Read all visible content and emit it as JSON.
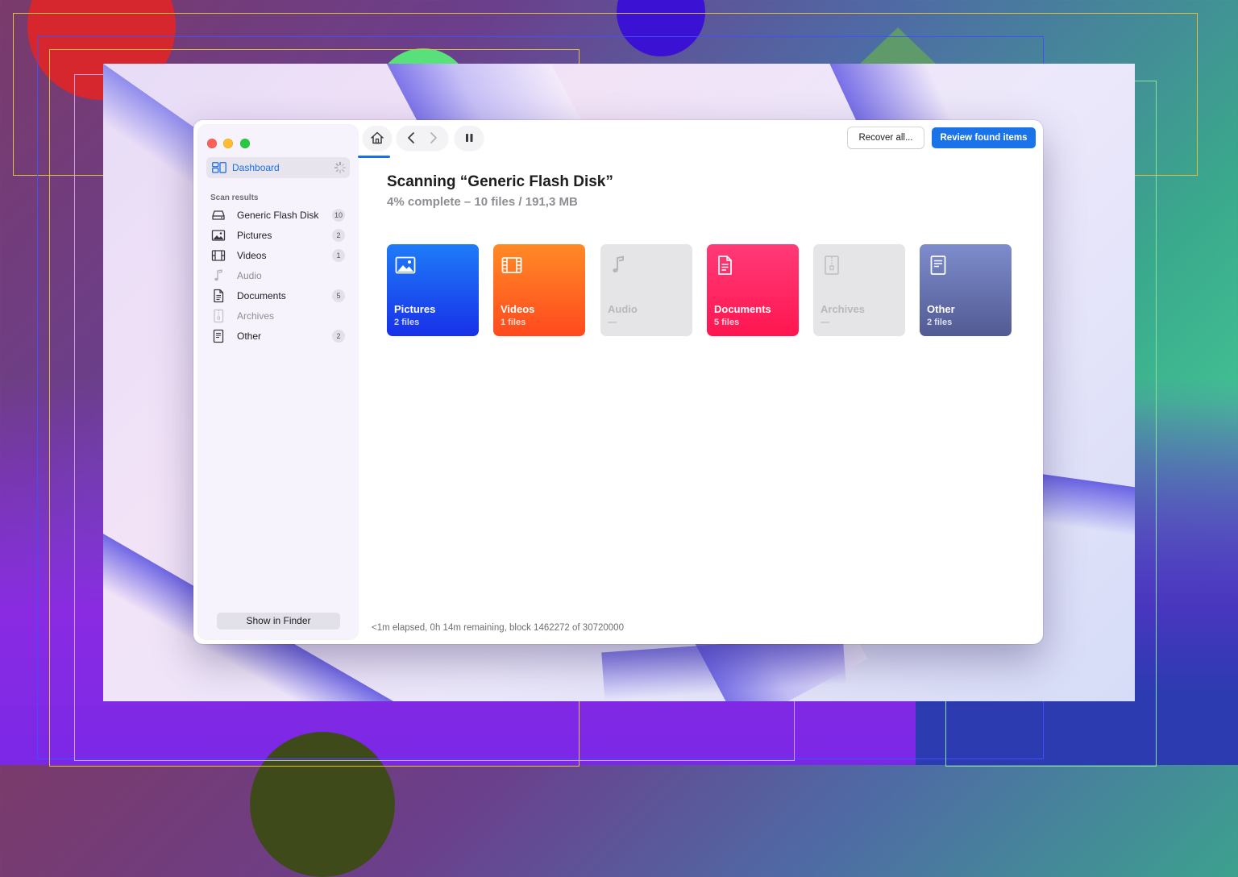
{
  "window": {
    "toolbar": {
      "recover_label": "Recover all...",
      "review_label": "Review found items"
    },
    "sidebar": {
      "dashboard_label": "Dashboard",
      "section_title": "Scan results",
      "items": [
        {
          "label": "Generic Flash Disk",
          "badge": "10",
          "icon": "drive-icon"
        },
        {
          "label": "Pictures",
          "badge": "2",
          "icon": "picture-icon"
        },
        {
          "label": "Videos",
          "badge": "1",
          "icon": "film-icon"
        },
        {
          "label": "Audio",
          "badge": "",
          "icon": "music-note-icon"
        },
        {
          "label": "Documents",
          "badge": "5",
          "icon": "document-icon"
        },
        {
          "label": "Archives",
          "badge": "",
          "icon": "archive-icon"
        },
        {
          "label": "Other",
          "badge": "2",
          "icon": "other-file-icon"
        }
      ],
      "finder_label": "Show in Finder"
    },
    "main": {
      "title": "Scanning “Generic Flash Disk”",
      "subtitle": "4% complete – 10 files / 191,3 MB",
      "cards": [
        {
          "name": "Pictures",
          "count": "2 files",
          "color": "#1e5cf0",
          "icon": "picture-icon"
        },
        {
          "name": "Videos",
          "count": "1 files",
          "color": "#ff6a22",
          "icon": "film-icon"
        },
        {
          "name": "Audio",
          "count": "—",
          "color": "#e5e5e7",
          "icon": "music-note-icon"
        },
        {
          "name": "Documents",
          "count": "5 files",
          "color": "#ff2864",
          "icon": "document-icon"
        },
        {
          "name": "Archives",
          "count": "—",
          "color": "#e5e5e7",
          "icon": "archive-icon"
        },
        {
          "name": "Other",
          "count": "2 files",
          "color": "#6a76b2",
          "icon": "other-file-icon"
        }
      ],
      "status": "<1m elapsed, 0h 14m remaining, block 1462272 of 30720000"
    }
  },
  "colors": {
    "accent": "#1a73e8"
  }
}
